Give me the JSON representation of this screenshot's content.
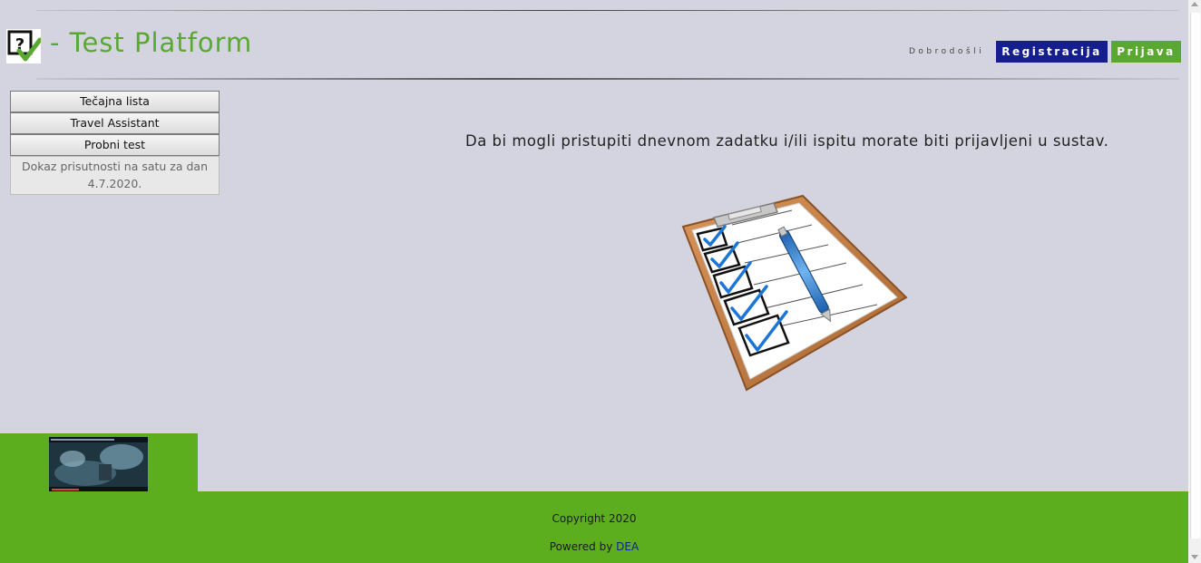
{
  "header": {
    "title": "- Test Platform",
    "welcome": "Dobrodošli",
    "register_label": "Registracija",
    "login_label": "Prijava"
  },
  "sidebar": {
    "items": [
      {
        "label": "Tečajna lista"
      },
      {
        "label": "Travel Assistant"
      },
      {
        "label": "Probni test"
      }
    ],
    "note_line1": "Dokaz prisutnosti na satu za dan",
    "note_line2": "4.7.2020."
  },
  "main": {
    "notice": "Da bi mogli pristupiti dnevnom zadatku i/ili ispitu morate biti prijavljeni u sustav."
  },
  "footer": {
    "copyright": "Copyright 2020",
    "powered_prefix": "Powered by",
    "powered_link": "DEA"
  },
  "icons": {
    "logo": "question-check-icon",
    "illustration": "clipboard-checklist-icon"
  },
  "colors": {
    "background": "#d4d4e0",
    "brand_green": "#5aa832",
    "footer_green": "#5dae1f",
    "register_blue": "#141e8c"
  }
}
